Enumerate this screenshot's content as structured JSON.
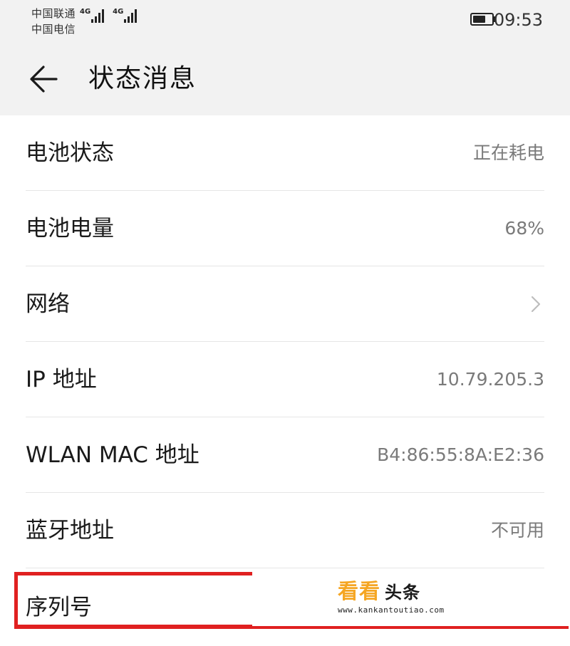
{
  "status_bar": {
    "carrier_1": "中国联通",
    "carrier_2": "中国电信",
    "network_1": "4G",
    "network_2": "4G",
    "battery_level": 0.68,
    "time": "09:53"
  },
  "app_bar": {
    "back_icon": "arrow-left-icon",
    "title": "状态消息"
  },
  "items": [
    {
      "label": "电池状态",
      "value": "正在耗电"
    },
    {
      "label": "电池电量",
      "value": "68%"
    },
    {
      "label": "网络",
      "value": "",
      "chevron": "chevron-right-icon"
    },
    {
      "label": "IP 地址",
      "value": "10.79.205.3"
    },
    {
      "label": "WLAN MAC 地址",
      "value": "B4:86:55:8A:E2:36"
    },
    {
      "label": "蓝牙地址",
      "value": "不可用"
    },
    {
      "label": "序列号",
      "value": ""
    }
  ],
  "watermark": {
    "text_a": "看看",
    "text_b": "头条",
    "url": "www.kankantoutiao.com"
  },
  "colors": {
    "highlight": "#e02020",
    "watermark_accent": "#f5a623",
    "header_bg": "#f2f2f2"
  }
}
